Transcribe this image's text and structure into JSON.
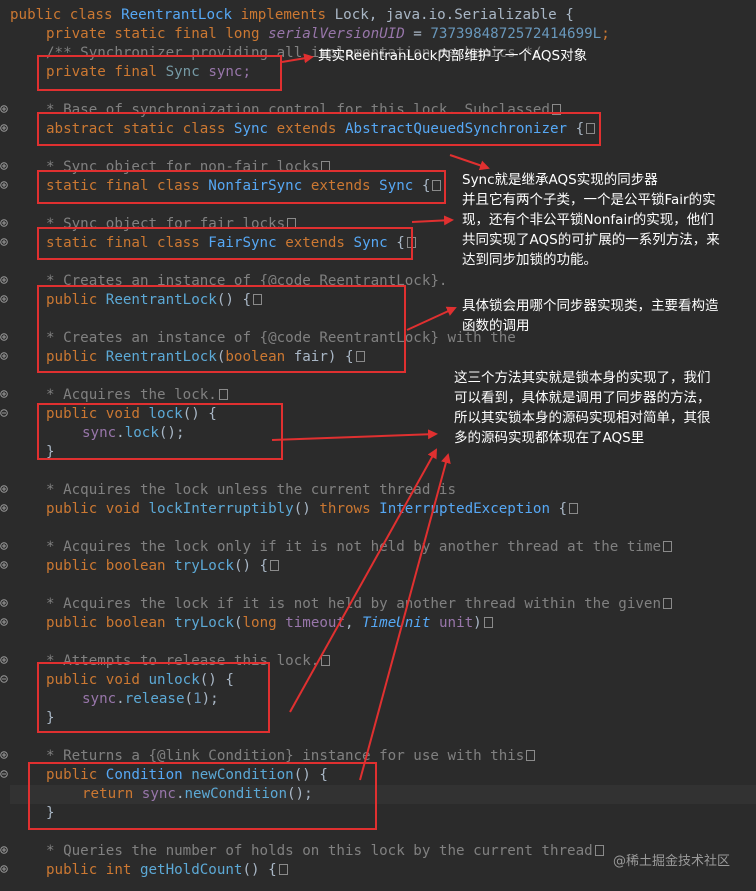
{
  "code": {
    "class_decl": {
      "kw1": "public",
      "kw2": "class",
      "name": "ReentrantLock",
      "kw3": "implements",
      "ifaces": "Lock, java.io.Serializable {"
    },
    "serial": {
      "mods": "private static final long",
      "name": "serialVersionUID",
      "eq": " = ",
      "val": "7373984872572414699L",
      ";": ";"
    },
    "sync_comment": "/** Synchronizer providing all implementation mechanics */",
    "sync_field": {
      "mods": "private final",
      "type": "Sync",
      "name": "sync;"
    },
    "c_base": "* Base of synchronization control for this lock. Subclassed",
    "abstract_decl": {
      "mods": "abstract static class",
      "name": "Sync",
      "kw": "extends",
      "parent": "AbstractQueuedSynchronizer",
      "tail": " {"
    },
    "c_nonfair": "* Sync object for non-fair locks",
    "nonfair_decl": {
      "mods": "static final class",
      "name": "NonfairSync",
      "kw": "extends",
      "parent": "Sync",
      "tail": " {"
    },
    "c_fair": "* Sync object for fair locks",
    "fair_decl": {
      "mods": "static final class",
      "name": "FairSync",
      "kw": "extends",
      "parent": "Sync",
      "tail": " {"
    },
    "c_creates": "* Creates an instance of {@code ReentrantLock}.",
    "ctor1": {
      "mods": "public",
      "name": "ReentrantLock",
      "args": "() {"
    },
    "c_creates2": "* Creates an instance of {@code ReentrantLock} with the",
    "ctor2": {
      "mods": "public",
      "name": "ReentrantLock",
      "open": "(",
      "ptype": "boolean",
      "pname": " fair",
      "close": ") {"
    },
    "c_acquires": "* Acquires the lock.",
    "lock_decl": {
      "mods": "public void",
      "name": "lock",
      "tail": "() {"
    },
    "lock_body": {
      "obj": "sync",
      "dot": ".",
      "call": "lock",
      "tail": "();"
    },
    "close1": "}",
    "c_acq_int": "* Acquires the lock unless the current thread is",
    "lockint": {
      "mods": "public void",
      "name": "lockInterruptibly",
      "paren": "() ",
      "kw": "throws",
      "exc": "InterruptedException",
      "tail": " {"
    },
    "c_trylock": "* Acquires the lock only if it is not held by another thread at the time",
    "trylock1": {
      "mods": "public boolean",
      "name": "tryLock",
      "tail": "() {"
    },
    "c_trylock2": "* Acquires the lock if it is not held by another thread within the given",
    "trylock2": {
      "mods": "public boolean",
      "name": "tryLock",
      "open": "(",
      "ptype": "long",
      "pname": "timeout",
      ",": ", ",
      "utype": "TimeUnit",
      "uname": "unit",
      "close": ")"
    },
    "c_release": "* Attempts to release this lock.",
    "unlock_decl": {
      "mods": "public void",
      "name": "unlock",
      "tail": "() {"
    },
    "unlock_body": {
      "obj": "sync",
      "dot": ".",
      "call": "release",
      "open": "(",
      "num": "1",
      "tail": ");"
    },
    "close2": "}",
    "c_returns": "* Returns a {@link Condition} instance for use with this",
    "newcond_decl": {
      "mods": "public",
      "type": "Condition",
      "name": "newCondition",
      "tail": "() {"
    },
    "newcond_body": {
      "kw": "return",
      "obj": "sync",
      "dot": ".",
      "call": "newCondition",
      "tail": "();"
    },
    "close3": "}",
    "c_queries": "* Queries the number of holds on this lock by the current thread",
    "getholds": {
      "mods": "public int",
      "name": "getHoldCount",
      "tail": "() {"
    }
  },
  "notes": {
    "n1": "其实ReentranLock内部维护了一个AQS对象",
    "n2": "Sync就是继承AQS实现的同步器\n并且它有两个子类，一个是公平锁Fair的实\n现，还有个非公平锁Nonfair的实现，他们\n共同实现了AQS的可扩展的一系列方法，来\n达到同步加锁的功能。",
    "n3": "具体锁会用哪个同步器实现类，主要看构造\n函数的调用",
    "n4": "这三个方法其实就是锁本身的实现了，我们\n可以看到，具体就是调用了同步器的方法，\n所以其实锁本身的源码实现相对简单，其很\n多的源码实现都体现在了AQS里"
  },
  "watermark": "@稀土掘金技术社区",
  "colors": {
    "background": "#2b2b2b",
    "annotation": "#e03030",
    "keyword": "#cc7832",
    "comment": "#808080"
  }
}
